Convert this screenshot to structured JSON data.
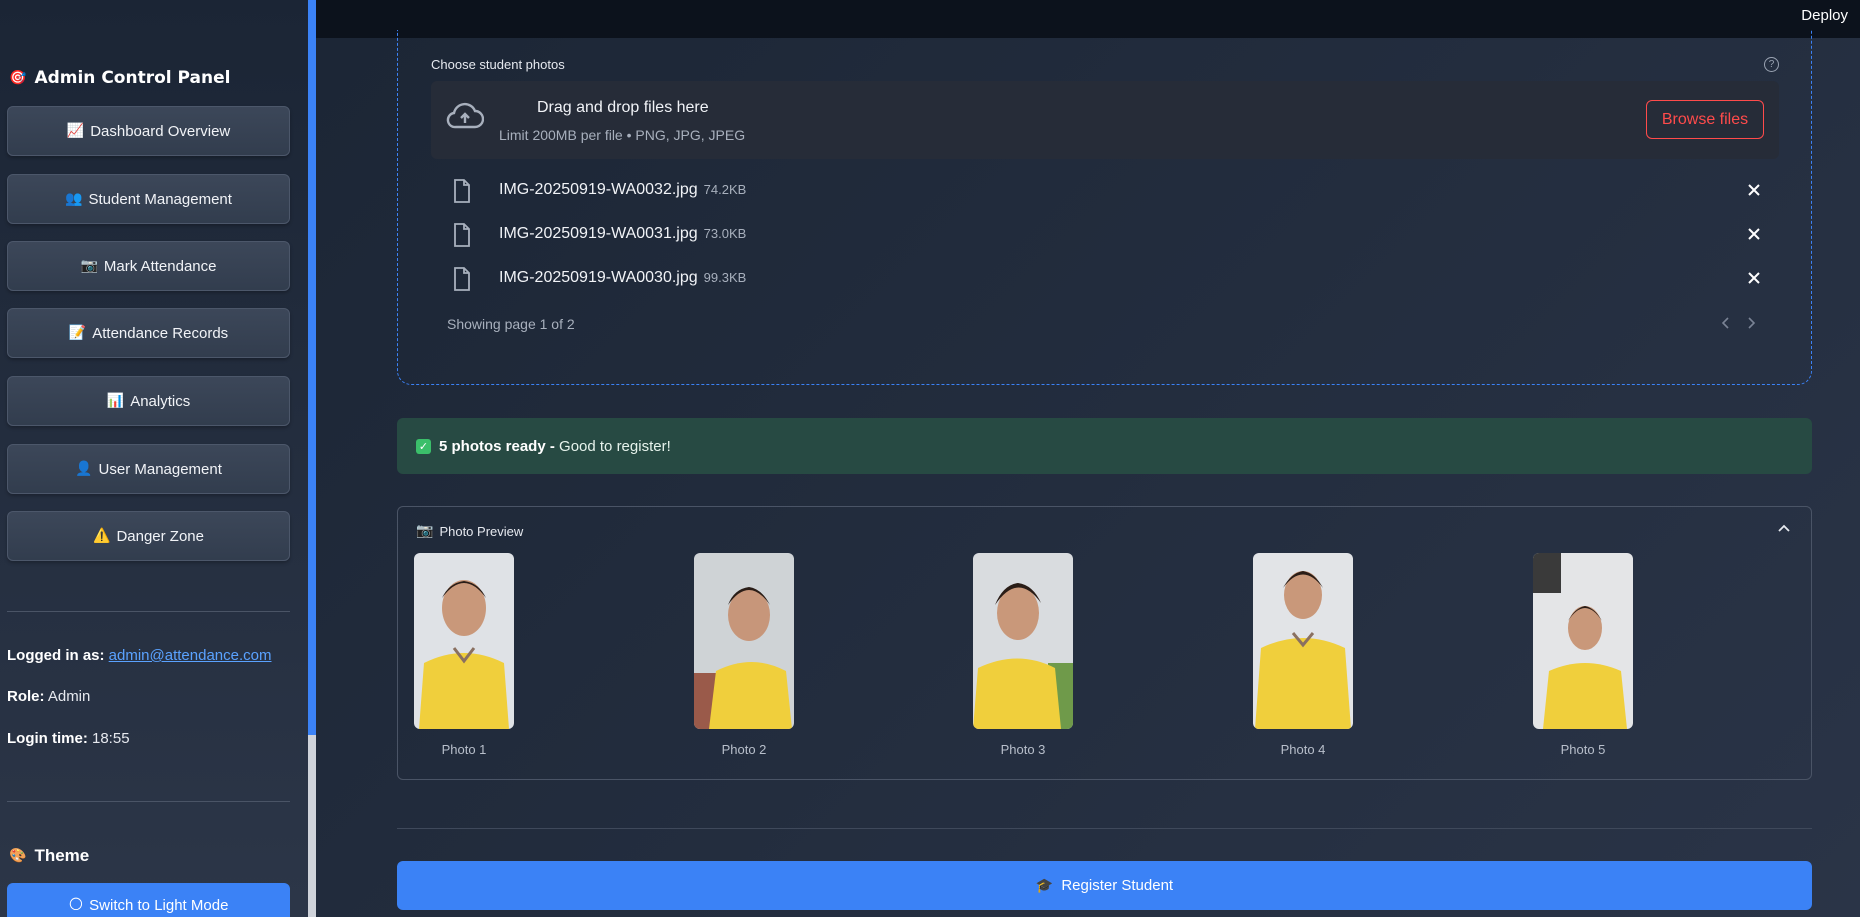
{
  "sidebar": {
    "title": "Admin Control Panel",
    "title_icon": "target-icon",
    "nav": [
      {
        "icon": "📈",
        "icon_name": "chart-up-icon",
        "label": "Dashboard Overview"
      },
      {
        "icon": "👥",
        "icon_name": "people-icon",
        "label": "Student Management"
      },
      {
        "icon": "📷",
        "icon_name": "camera-icon",
        "label": "Mark Attendance"
      },
      {
        "icon": "📝",
        "icon_name": "memo-icon",
        "label": "Attendance Records"
      },
      {
        "icon": "📊",
        "icon_name": "bar-chart-icon",
        "label": "Analytics"
      },
      {
        "icon": "👤",
        "icon_name": "user-icon",
        "label": "User Management"
      },
      {
        "icon": "⚠️",
        "icon_name": "warning-icon",
        "label": "Danger Zone"
      }
    ],
    "logged_in_label": "Logged in as:",
    "logged_in_value": "admin@attendance.com",
    "role_label": "Role:",
    "role_value": "Admin",
    "login_time_label": "Login time:",
    "login_time_value": "18:55",
    "theme_title": "Theme",
    "theme_button": "Switch to Light Mode"
  },
  "topbar": {
    "deploy_label": "Deploy"
  },
  "uploader": {
    "label": "Choose student photos",
    "help_icon": "?",
    "dropzone_title": "Drag and drop files here",
    "dropzone_sub": "Limit 200MB per file • PNG, JPG, JPEG",
    "browse_label": "Browse files",
    "files": [
      {
        "name": "IMG-20250919-WA0032.jpg",
        "size": "74.2KB"
      },
      {
        "name": "IMG-20250919-WA0031.jpg",
        "size": "73.0KB"
      },
      {
        "name": "IMG-20250919-WA0030.jpg",
        "size": "99.3KB"
      }
    ],
    "page_text": "Showing page 1 of 2"
  },
  "success": {
    "bold": "5 photos ready -",
    "text": " Good to register!"
  },
  "preview": {
    "title": "Photo Preview",
    "photos": [
      "Photo 1",
      "Photo 2",
      "Photo 3",
      "Photo 4",
      "Photo 5"
    ]
  },
  "register_button": "Register Student",
  "colors": {
    "accent": "#3b82f6",
    "danger": "#ff4b4b",
    "success_bg": "#274a43"
  }
}
